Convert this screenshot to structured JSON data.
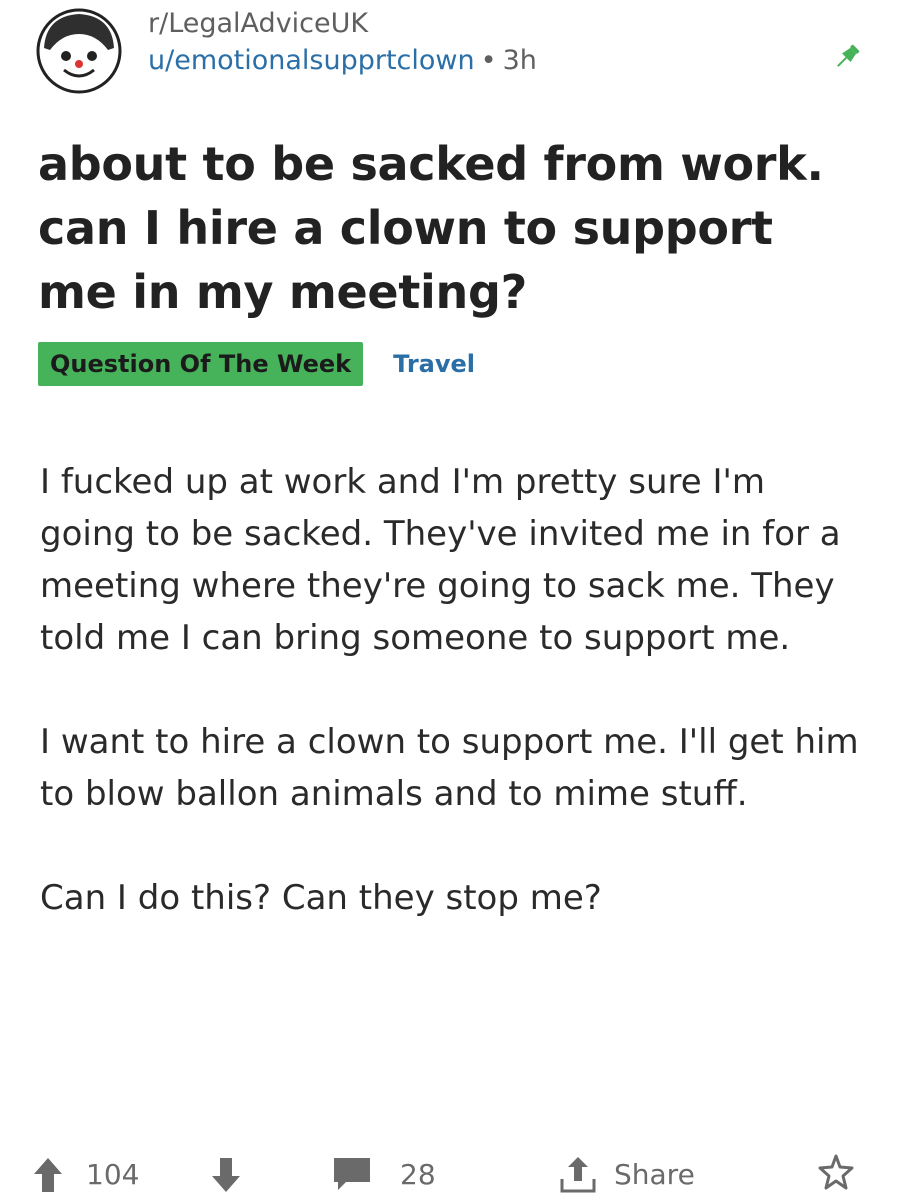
{
  "post": {
    "subreddit": "r/LegalAdviceUK",
    "username": "u/emotionalsupprtclown",
    "separator": "•",
    "time": "3h",
    "title": "about to be sacked from work. can I hire a clown to support me in my meeting?",
    "flairs": {
      "primary": "Question Of The Week",
      "secondary": "Travel"
    },
    "body": [
      "I fucked up at work and I'm pretty sure I'm going to be sacked. They've invited me in for a meeting where they're going to sack me. They told me I can bring someone to support me.",
      "I want to hire a clown to support me. I'll get him to blow ballon animals and to mime stuff.",
      "Can I do this? Can they stop me?"
    ]
  },
  "footer": {
    "score": "104",
    "comments": "28",
    "share_label": "Share"
  },
  "icons": {
    "avatar": "reddit-avatar-icon",
    "pin": "pin-icon",
    "upvote": "upvote-arrow-icon",
    "downvote": "downvote-arrow-icon",
    "comment": "comment-bubble-icon",
    "share": "share-icon",
    "award": "award-icon"
  },
  "colors": {
    "pin": "#46b35a",
    "flair_primary_bg": "#46b35a",
    "flair_secondary_text": "#2b6ea6",
    "username": "#2a6fa8"
  }
}
